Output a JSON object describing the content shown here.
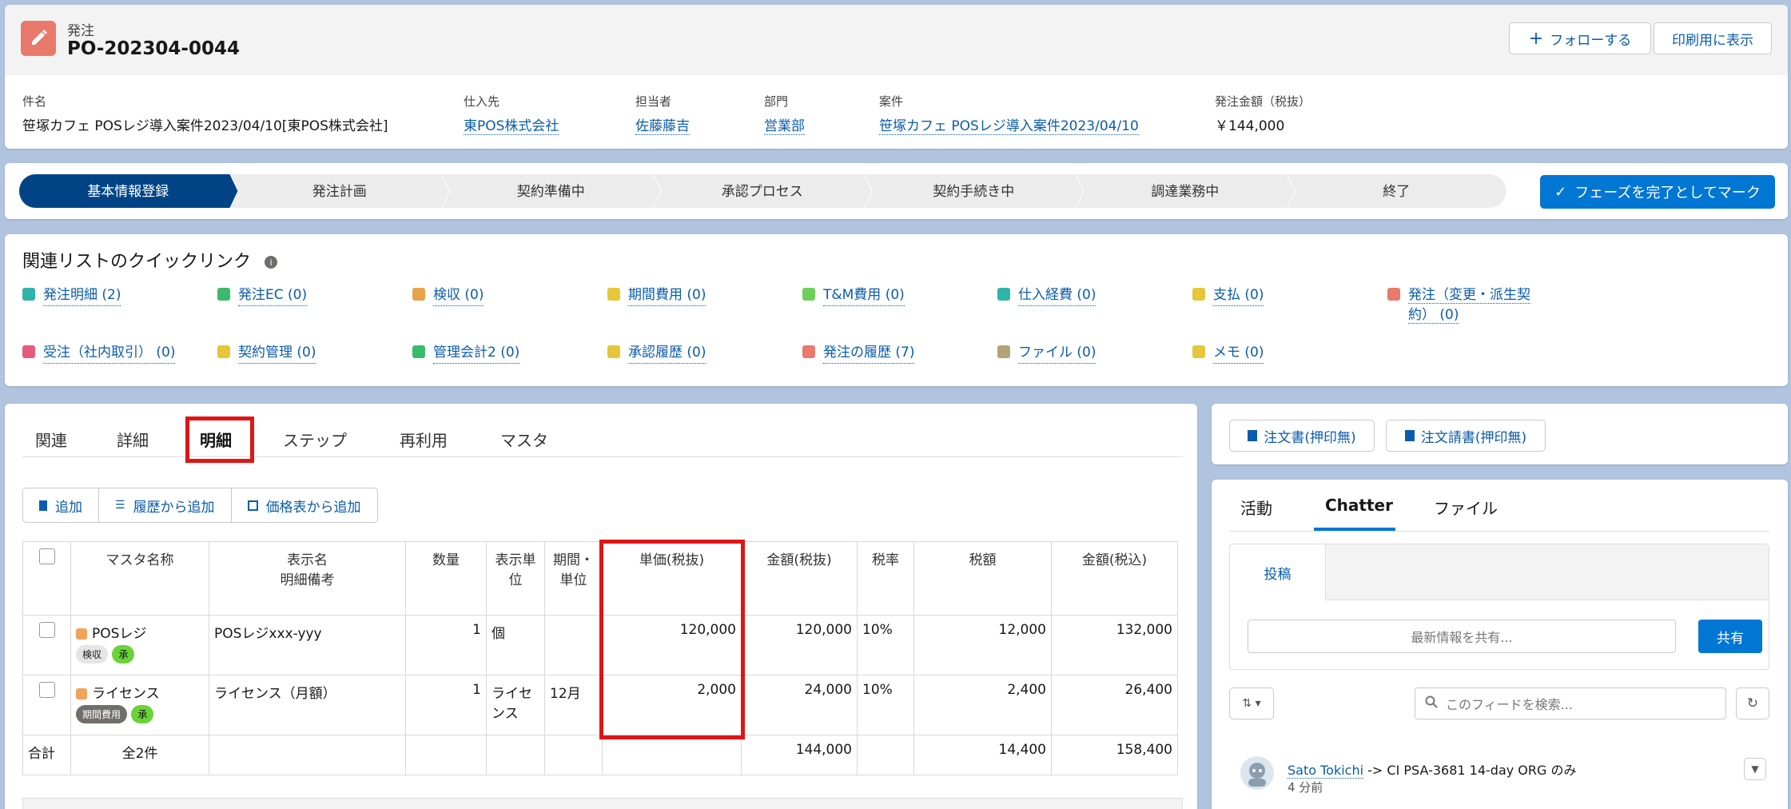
{
  "header": {
    "object_type": "発注",
    "record_name": "PO-202304-0044",
    "follow_label": "フォローする",
    "print_label": "印刷用に表示",
    "fields": [
      {
        "label": "件名",
        "value": "笹塚カフェ POSレジ導入案件2023/04/10[東POS株式会社]",
        "link": false
      },
      {
        "label": "仕入先",
        "value": "東POS株式会社",
        "link": true
      },
      {
        "label": "担当者",
        "value": "佐藤藤吉",
        "link": true
      },
      {
        "label": "部門",
        "value": "営業部",
        "link": true
      },
      {
        "label": "案件",
        "value": "笹塚カフェ POSレジ導入案件2023/04/10",
        "link": true
      },
      {
        "label": "発注金額（税抜）",
        "value": "￥144,000",
        "link": false
      }
    ]
  },
  "path": {
    "stages": [
      "基本情報登録",
      "発注計画",
      "契約準備中",
      "承認プロセス",
      "契約手続き中",
      "調達業務中",
      "終了"
    ],
    "active_index": 0,
    "mark_label": "フェーズを完了としてマーク"
  },
  "quick_links": {
    "title": "関連リストのクイックリンク",
    "row1": [
      {
        "label": "発注明細 (2)",
        "color": "#2fb5a8"
      },
      {
        "label": "発注EC (0)",
        "color": "#3bba6b"
      },
      {
        "label": "検収 (0)",
        "color": "#e6a34b"
      },
      {
        "label": "期間費用 (0)",
        "color": "#e6c63a"
      },
      {
        "label": "T&M費用 (0)",
        "color": "#6ccf5a"
      },
      {
        "label": "仕入経費 (0)",
        "color": "#2fb5a8"
      },
      {
        "label": "支払 (0)",
        "color": "#e6c63a"
      },
      {
        "label": "発注（変更・派生契",
        "label2": "約） (0)",
        "color": "#e8796b"
      }
    ],
    "row2": [
      {
        "label": "受注（社内取引） (0)",
        "color": "#e65b7b"
      },
      {
        "label": "契約管理 (0)",
        "color": "#e6c63a"
      },
      {
        "label": "管理会計2 (0)",
        "color": "#3bba6b"
      },
      {
        "label": "承認履歴 (0)",
        "color": "#e6c63a"
      },
      {
        "label": "発注の履歴 (7)",
        "color": "#e8796b"
      },
      {
        "label": "ファイル (0)",
        "color": "#b5a17a"
      },
      {
        "label": "メモ (0)",
        "color": "#e6c63a"
      }
    ]
  },
  "tabs": [
    "関連",
    "詳細",
    "明細",
    "ステップ",
    "再利用",
    "マスタ"
  ],
  "actions": [
    "追加",
    "履歴から追加",
    "価格表から追加"
  ],
  "table": {
    "headers": {
      "master": "マスタ名称",
      "display": "表示名",
      "display2": "明細備考",
      "qty": "数量",
      "unit": "表示単位",
      "period": "期間・単位",
      "price": "単価(税抜)",
      "amount": "金額(税抜)",
      "rate": "税率",
      "tax": "税額",
      "total": "金額(税込)"
    },
    "rows": [
      {
        "master": "POSレジ",
        "tags": [
          "検収",
          "承"
        ],
        "display": "POSレジxxx-yyy",
        "qty": "1",
        "unit": "個",
        "period": "",
        "price": "120,000",
        "amount": "120,000",
        "rate": "10%",
        "tax": "12,000",
        "total": "132,000"
      },
      {
        "master": "ライセンス",
        "tags": [
          "期間費用",
          "承"
        ],
        "display": "ライセンス（月額）",
        "qty": "1",
        "unit": "ライセンス",
        "period": "12月",
        "price": "2,000",
        "amount": "24,000",
        "rate": "10%",
        "tax": "2,400",
        "total": "26,400"
      }
    ],
    "footer": {
      "label": "合計",
      "count": "全2件",
      "amount": "144,000",
      "tax": "14,400",
      "total": "158,400"
    }
  },
  "right": {
    "order_btn1": "注文書(押印無)",
    "order_btn2": "注文請書(押印無)",
    "tabs": [
      "活動",
      "Chatter",
      "ファイル"
    ],
    "post_tab": "投稿",
    "share_placeholder": "最新情報を共有...",
    "share_btn": "共有",
    "search_placeholder": "このフィードを検索...",
    "feed_user": "Sato Tokichi",
    "feed_text": " -> CI PSA-3681 14-day ORG のみ",
    "feed_time": "4 分前"
  }
}
